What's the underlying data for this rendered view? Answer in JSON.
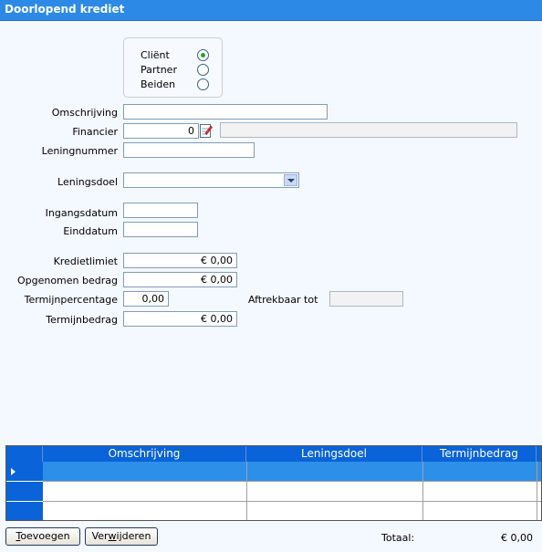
{
  "window": {
    "title": "Doorlopend krediet"
  },
  "owner": {
    "options": [
      {
        "label": "Cliënt",
        "checked": true
      },
      {
        "label": "Partner",
        "checked": false
      },
      {
        "label": "Beiden",
        "checked": false
      }
    ]
  },
  "form": {
    "omschrijving": {
      "label": "Omschrijving",
      "value": ""
    },
    "financier": {
      "label": "Financier",
      "code": "0",
      "name": ""
    },
    "leningnummer": {
      "label": "Leningnummer",
      "value": ""
    },
    "leningsdoel": {
      "label": "Leningsdoel",
      "value": ""
    },
    "ingangsdatum": {
      "label": "Ingangsdatum",
      "value": ""
    },
    "einddatum": {
      "label": "Einddatum",
      "value": ""
    },
    "kredietlimiet": {
      "label": "Kredietlimiet",
      "value": "€ 0,00"
    },
    "opgenomen_bedrag": {
      "label": "Opgenomen bedrag",
      "value": "€ 0,00"
    },
    "termijnpercentage": {
      "label": "Termijnpercentage",
      "value": "0,00"
    },
    "aftrekbaar_tot": {
      "label": "Aftrekbaar tot",
      "value": ""
    },
    "termijnbedrag": {
      "label": "Termijnbedrag",
      "value": "€ 0,00"
    }
  },
  "grid": {
    "columns": [
      "Omschrijving",
      "Leningsdoel",
      "Termijnbedrag"
    ],
    "rows": [
      [
        "",
        "",
        ""
      ],
      [
        "",
        "",
        ""
      ],
      [
        "",
        "",
        ""
      ]
    ]
  },
  "footer": {
    "add_prefix": "",
    "add_hotkey": "T",
    "add_rest": "oevoegen",
    "remove_prefix": "Ver",
    "remove_hotkey": "w",
    "remove_rest": "ijderen",
    "total_label": "Totaal:",
    "total_value": "€ 0,00"
  },
  "colors": {
    "accent": "#2c8ae6",
    "grid_header": "#0a63d8",
    "selected_row": "#2d8fe8"
  }
}
